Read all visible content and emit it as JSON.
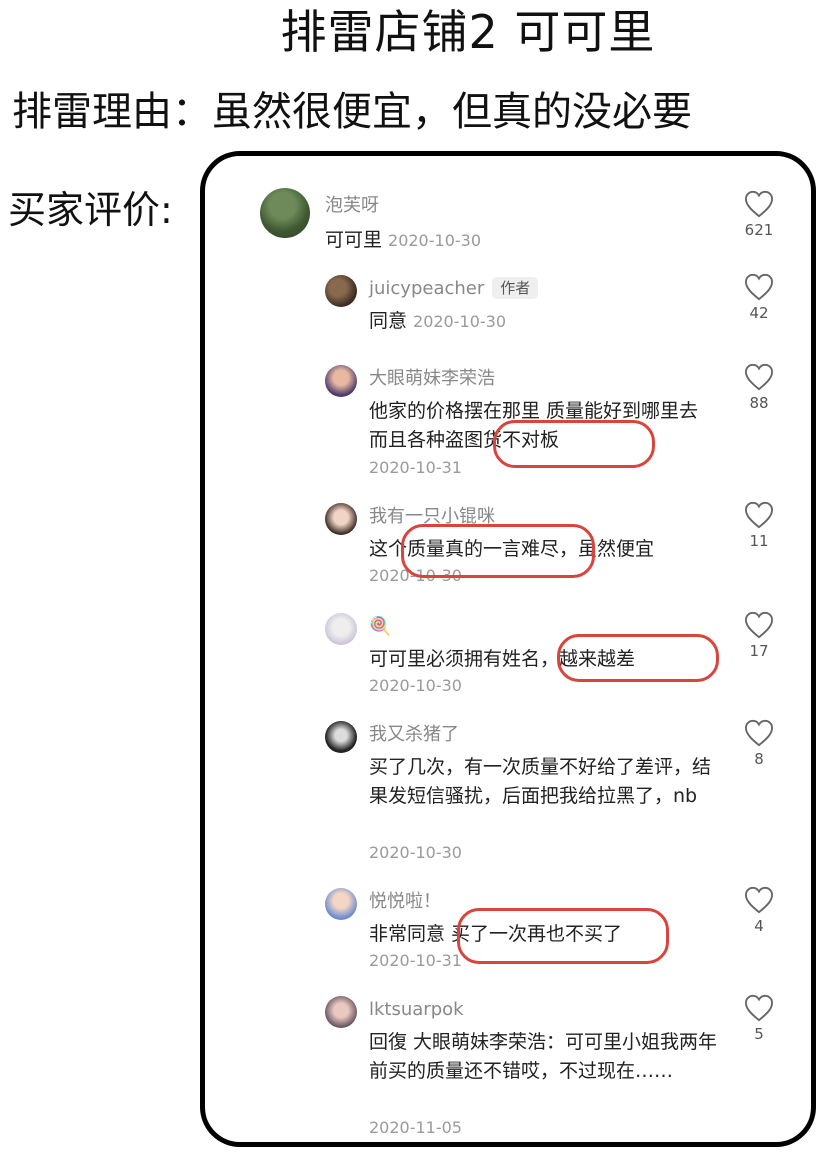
{
  "title": "排雷店铺2  可可里",
  "reason": "排雷理由：虽然很便宜，但真的没必要",
  "buyer_label": "买家评价:",
  "top_comment": {
    "user": "泡芙呀",
    "text": "可可里",
    "date": "2020-10-30",
    "likes": "621"
  },
  "replies": [
    {
      "user": "juicypeacher",
      "badge": "作者",
      "text": "同意",
      "date": "2020-10-30",
      "likes": "42"
    },
    {
      "user": "大眼萌妹李荣浩",
      "text": "他家的价格摆在那里 质量能好到哪里去 而且各种盗图货不对板",
      "date": "2020-10-31",
      "likes": "88"
    },
    {
      "user": "我有一只小锟咪",
      "text": "这个质量真的一言难尽，虽然便宜",
      "date": "2020-10-30",
      "likes": "11"
    },
    {
      "user": "🍭",
      "text": "可可里必须拥有姓名，越来越差",
      "date": "2020-10-30",
      "likes": "17"
    },
    {
      "user": "我又杀猪了",
      "text": "买了几次，有一次质量不好给了差评，结果发短信骚扰，后面把我给拉黑了，nb",
      "date": "2020-10-30",
      "likes": "8"
    },
    {
      "user": "悦悦啦！",
      "text": "非常同意 买了一次再也不买了",
      "date": "2020-10-31",
      "likes": "4"
    },
    {
      "user": "lktsuarpok",
      "text": "回復 大眼萌妹李荣浩：可可里小姐我两年前买的质量还不错哎，不过现在……",
      "date": "2020-11-05",
      "likes": "5"
    }
  ],
  "colors": {
    "highlight": "#d9443c",
    "muted": "#888888"
  },
  "icons": {
    "like": "heart-outline-icon"
  }
}
